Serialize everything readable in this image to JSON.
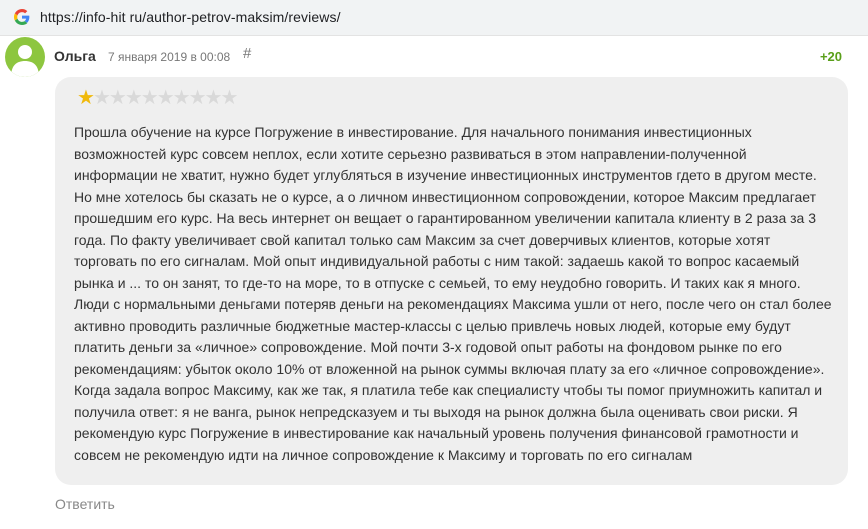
{
  "browser": {
    "url": "https://info-hit ru/author-petrov-maksim/reviews/",
    "site_icon": "google-g-icon"
  },
  "comment": {
    "author": "Ольга",
    "date": "7 января 2019 в 00:08",
    "anchor_symbol": "#",
    "score": "+20",
    "rating": {
      "value": 1,
      "max": 10
    },
    "text": "Прошла обучение на курсе Погружение в инвестирование. Для начального понимания инвестиционных возможностей курс совсем неплох, если хотите серьезно развиваться в этом направлении-полученной информации не хватит, нужно будет углубляться в изучение инвестиционных инструментов гдето в другом месте. Но мне хотелось бы сказать не о курсе, а о личном инвестиционном сопровождении, которое Максим предлагает прошедшим его курс. На весь интернет он вещает о гарантированном увеличении капитала клиенту в 2 раза за 3 года. По факту увеличивает свой капитал только сам Максим за счет доверчивых клиентов, которые хотят торговать по его сигналам. Мой опыт индивидуальной работы с ним такой: задаешь какой то вопрос касаемый рынка и ... то он занят, то где-то на море, то в отпуске с семьей, то ему неудобно говорить. И таких как я много. Люди с нормальными деньгами потеряв деньги на рекомендациях Максима ушли от него, после чего он стал более активно проводить различные бюджетные мастер-классы с целью привлечь новых людей, которые ему будут платить деньги за «личное» сопровождение. Мой почти 3-х годовой опыт работы на фондовом рынке по его рекомендациям: убыток около 10% от вложенной на рынок суммы включая плату за его «личное сопровождение». Когда задала вопрос Максиму, как же так, я платила тебе как специалисту чтобы ты помог приумножить капитал и получила ответ: я не ванга, рынок непредсказуем и ты выходя на рынок должна была оценивать свои риски. Я рекомендую курс Погружение в инвестирование как начальный уровень получения финансовой грамотности и совсем не рекомендую идти на личное сопровождение к Максиму и торговать по его сигналам",
    "reply_label": "Ответить"
  },
  "colors": {
    "avatar": "#8dc63f",
    "score": "#5a9f1a",
    "star_active": "#f0b90b",
    "star_inactive": "#d9d9d9",
    "bubble": "#efefef"
  }
}
